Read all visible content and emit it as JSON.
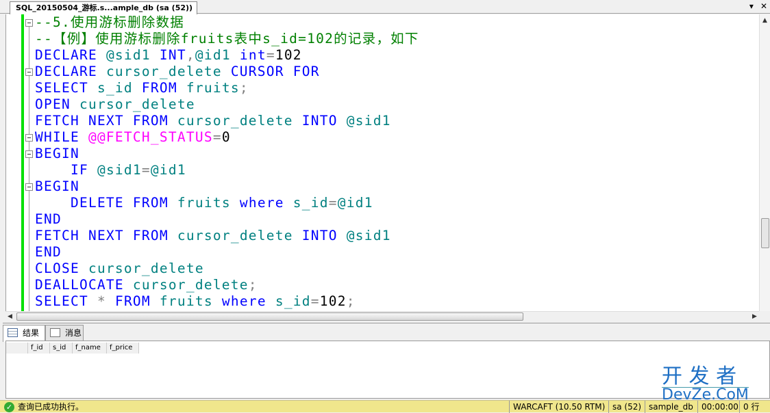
{
  "tab": {
    "title": "SQL_20150504_游标.s...ample_db (sa (52))",
    "pin": "▾",
    "close": "✕"
  },
  "code": [
    [
      [
        "--5.使用游标删除数据",
        "cm"
      ]
    ],
    [
      [
        "--【例】使用游标删除fruits表中s_id=102的记录，如下",
        "cm"
      ]
    ],
    [
      [
        "DECLARE",
        "kw"
      ],
      [
        " ",
        ""
      ],
      [
        "@sid1",
        "id"
      ],
      [
        " ",
        ""
      ],
      [
        "INT",
        "kw"
      ],
      [
        ",",
        "op"
      ],
      [
        "@id1",
        "id"
      ],
      [
        " ",
        ""
      ],
      [
        "int",
        "kw"
      ],
      [
        "=",
        "op"
      ],
      [
        "102",
        "num"
      ]
    ],
    [
      [
        "DECLARE",
        "kw"
      ],
      [
        " ",
        ""
      ],
      [
        "cursor_delete",
        "id"
      ],
      [
        " ",
        ""
      ],
      [
        "CURSOR",
        "kw"
      ],
      [
        " ",
        ""
      ],
      [
        "FOR",
        "kw"
      ]
    ],
    [
      [
        "SELECT",
        "kw"
      ],
      [
        " ",
        ""
      ],
      [
        "s_id",
        "id"
      ],
      [
        " ",
        ""
      ],
      [
        "FROM",
        "kw"
      ],
      [
        " ",
        ""
      ],
      [
        "fruits",
        "id"
      ],
      [
        ";",
        "op"
      ]
    ],
    [
      [
        "OPEN",
        "kw"
      ],
      [
        " ",
        ""
      ],
      [
        "cursor_delete",
        "id"
      ]
    ],
    [
      [
        "FETCH",
        "kw"
      ],
      [
        " ",
        ""
      ],
      [
        "NEXT",
        "kw"
      ],
      [
        " ",
        ""
      ],
      [
        "FROM",
        "kw"
      ],
      [
        " ",
        ""
      ],
      [
        "cursor_delete",
        "id"
      ],
      [
        " ",
        ""
      ],
      [
        "INTO",
        "kw"
      ],
      [
        " ",
        ""
      ],
      [
        "@sid1",
        "id"
      ]
    ],
    [
      [
        "WHILE",
        "kw"
      ],
      [
        " ",
        ""
      ],
      [
        "@@FETCH_STATUS",
        "sys"
      ],
      [
        "=",
        "op"
      ],
      [
        "0",
        "num"
      ]
    ],
    [
      [
        "BEGIN",
        "kw"
      ]
    ],
    [
      [
        "    ",
        ""
      ],
      [
        "IF",
        "kw"
      ],
      [
        " ",
        ""
      ],
      [
        "@sid1",
        "id"
      ],
      [
        "=",
        "op"
      ],
      [
        "@id1",
        "id"
      ]
    ],
    [
      [
        "BEGIN",
        "kw"
      ]
    ],
    [
      [
        "    ",
        ""
      ],
      [
        "DELETE",
        "kw"
      ],
      [
        " ",
        ""
      ],
      [
        "FROM",
        "kw"
      ],
      [
        " ",
        ""
      ],
      [
        "fruits",
        "id"
      ],
      [
        " ",
        ""
      ],
      [
        "where",
        "kw"
      ],
      [
        " ",
        ""
      ],
      [
        "s_id",
        "id"
      ],
      [
        "=",
        "op"
      ],
      [
        "@id1",
        "id"
      ]
    ],
    [
      [
        "END",
        "kw"
      ]
    ],
    [
      [
        "FETCH",
        "kw"
      ],
      [
        " ",
        ""
      ],
      [
        "NEXT",
        "kw"
      ],
      [
        " ",
        ""
      ],
      [
        "FROM",
        "kw"
      ],
      [
        " ",
        ""
      ],
      [
        "cursor_delete",
        "id"
      ],
      [
        " ",
        ""
      ],
      [
        "INTO",
        "kw"
      ],
      [
        " ",
        ""
      ],
      [
        "@sid1",
        "id"
      ]
    ],
    [
      [
        "END",
        "kw"
      ]
    ],
    [
      [
        "CLOSE",
        "kw"
      ],
      [
        " ",
        ""
      ],
      [
        "cursor_delete",
        "id"
      ]
    ],
    [
      [
        "DEALLOCATE",
        "kw"
      ],
      [
        " ",
        ""
      ],
      [
        "cursor_delete",
        "id"
      ],
      [
        ";",
        "op"
      ]
    ],
    [
      [
        "SELECT",
        "kw"
      ],
      [
        " ",
        ""
      ],
      [
        "*",
        "op"
      ],
      [
        " ",
        ""
      ],
      [
        "FROM",
        "kw"
      ],
      [
        " ",
        ""
      ],
      [
        "fruits",
        "id"
      ],
      [
        " ",
        ""
      ],
      [
        "where",
        "kw"
      ],
      [
        " ",
        ""
      ],
      [
        "s_id",
        "id"
      ],
      [
        "=",
        "op"
      ],
      [
        "102",
        "num"
      ],
      [
        ";",
        "op"
      ]
    ]
  ],
  "folds": [
    0,
    3,
    7,
    8,
    10
  ],
  "results": {
    "tabs": [
      {
        "label": "结果",
        "icon": "grid-icon"
      },
      {
        "label": "消息",
        "icon": "message-icon"
      }
    ],
    "columns": [
      "f_id",
      "s_id",
      "f_name",
      "f_price"
    ]
  },
  "status": {
    "message": "查询已成功执行。",
    "server": "WARCAFT (10.50 RTM)",
    "user": "sa (52)",
    "database": "sample_db",
    "time": "00:00:00",
    "rows": "0 行"
  },
  "watermark": {
    "line1": "开 发 者",
    "line2": "DevZe.CoM"
  },
  "colors": {
    "keyword": "#0000ff",
    "comment": "#008000",
    "identifier": "#008080",
    "system": "#ff00ff",
    "status_bar": "#f0e68c"
  }
}
